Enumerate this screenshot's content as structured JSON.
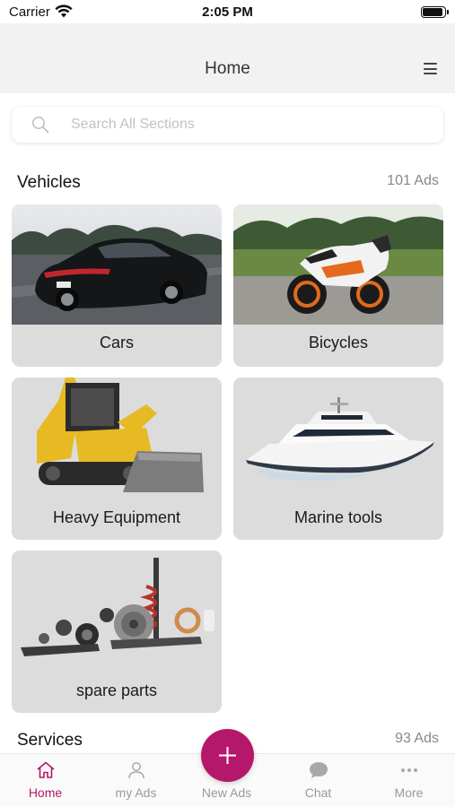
{
  "status_bar": {
    "carrier": "Carrier",
    "time": "2:05 PM"
  },
  "nav": {
    "title": "Home",
    "menu_icon": "hamburger-menu-icon"
  },
  "search": {
    "placeholder": "Search All Sections",
    "value": ""
  },
  "sections": {
    "vehicles": {
      "title": "Vehicles",
      "count": "101 Ads",
      "categories": [
        {
          "label": "Cars",
          "image": "black-sports-sedan"
        },
        {
          "label": "Bicycles",
          "image": "orange-white-motorcycle"
        },
        {
          "label": "Heavy Equipment",
          "image": "yellow-skid-steer-loader"
        },
        {
          "label": "Marine tools",
          "image": "white-yacht"
        },
        {
          "label": "spare parts",
          "image": "auto-spare-parts"
        }
      ]
    },
    "services": {
      "title": "Services",
      "count": "93 Ads"
    }
  },
  "tab_bar": {
    "tabs": [
      {
        "label": "Home",
        "icon": "home-icon",
        "active": true
      },
      {
        "label": "my Ads",
        "icon": "user-icon",
        "active": false
      },
      {
        "label": "New Ads",
        "icon": "plus-icon",
        "active": false
      },
      {
        "label": "Chat",
        "icon": "chat-bubble-icon",
        "active": false
      },
      {
        "label": "More",
        "icon": "more-dots-icon",
        "active": false
      }
    ],
    "accent_color": "#b5176a"
  }
}
